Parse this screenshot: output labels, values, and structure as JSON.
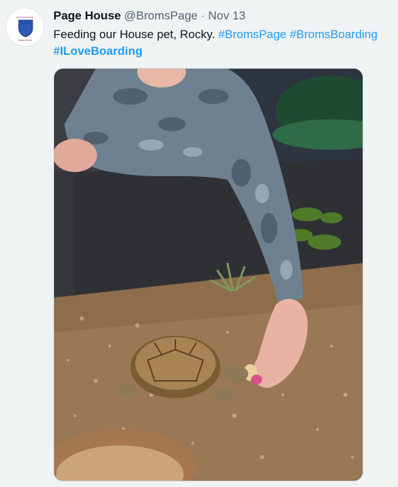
{
  "tweet": {
    "author_name": "Page House",
    "author_handle": "@BromsPage",
    "separator": "·",
    "date": "Nov 13",
    "text": "Feeding our House pet, Rocky.",
    "hashtags": [
      "#BromsPage",
      "#BromsBoarding",
      "#ILoveBoarding"
    ],
    "avatar": {
      "top_text": "BROMSGROVE",
      "bottom_text": "PAGE HOUSE",
      "icon": "shield-crest-icon"
    },
    "media": {
      "icon": "photo"
    }
  },
  "colors": {
    "background": "#f0f3f4",
    "name": "#0f1419",
    "meta": "#536471",
    "link": "#1d9bf0"
  }
}
